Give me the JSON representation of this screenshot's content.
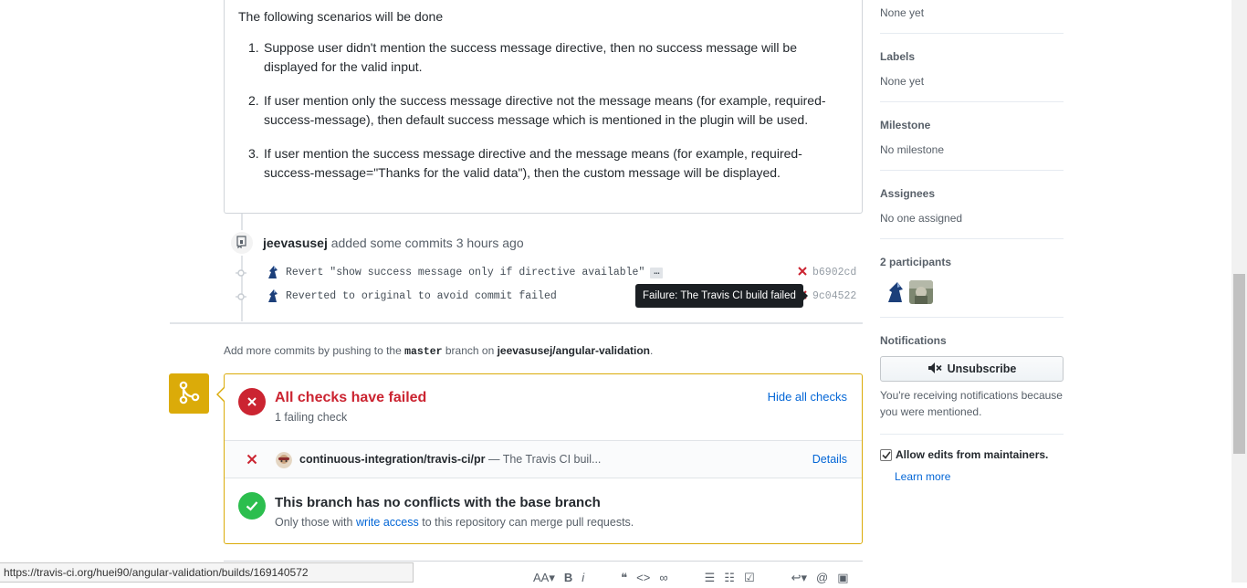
{
  "description": {
    "intro": "The following scenarios will be done",
    "scenarios": [
      {
        "num": "1.",
        "text": "Suppose user didn't mention the success message directive, then no success message will be displayed for the valid input."
      },
      {
        "num": "2.",
        "text": "If user mention only the success message directive not the message means (for example, required-success-message), then default success message which is mentioned in the plugin will be used."
      },
      {
        "num": "3.",
        "text": "If user mention the success message directive and the message means (for example, required-success-message=\"Thanks for the valid data\"), then the custom message will be displayed."
      }
    ]
  },
  "timeline": {
    "author": "jeevasusej",
    "action": "added some commits",
    "time": "3 hours ago",
    "commits": [
      {
        "message": "Revert \"show success message only if directive available\"",
        "ellipsis": "…",
        "sha": "b6902cd",
        "status_icon": "x-icon"
      },
      {
        "message": "Reverted to original to avoid commit failed",
        "sha": "9c04522",
        "status_icon": "x-icon"
      }
    ],
    "tooltip": "Failure: The Travis CI build failed"
  },
  "push_note": {
    "prefix": "Add more commits by pushing to the",
    "branch": "master",
    "middle": "branch on",
    "repo": "jeevasusej/angular-validation",
    "suffix": "."
  },
  "merge": {
    "checks_title": "All checks have failed",
    "checks_sub": "1 failing check",
    "hide_checks": "Hide all checks",
    "check": {
      "context": "continuous-integration/travis-ci/pr",
      "desc": " — The Travis CI buil...",
      "details": "Details"
    },
    "conflict_title": "This branch has no conflicts with the base branch",
    "conflict_prefix": "Only those with",
    "conflict_link": "write access",
    "conflict_suffix": "to this repository can merge pull requests.",
    "colors": {
      "failure": "#cb2431",
      "success": "#2cbe4e",
      "warning": "#dbab09"
    }
  },
  "sidebar": {
    "reviewers_value": "None yet",
    "labels_head": "Labels",
    "labels_value": "None yet",
    "milestone_head": "Milestone",
    "milestone_value": "No milestone",
    "assignees_head": "Assignees",
    "assignees_value": "No one assigned",
    "participants_head": "2 participants",
    "notifications_head": "Notifications",
    "unsubscribe": "Unsubscribe",
    "notif_note": "You're receiving notifications because you were mentioned.",
    "allow_edits": "Allow edits from maintainers.",
    "learn_more": "Learn more"
  },
  "status_bar": {
    "url": "https://travis-ci.org/huei90/angular-validation/builds/169140572"
  }
}
